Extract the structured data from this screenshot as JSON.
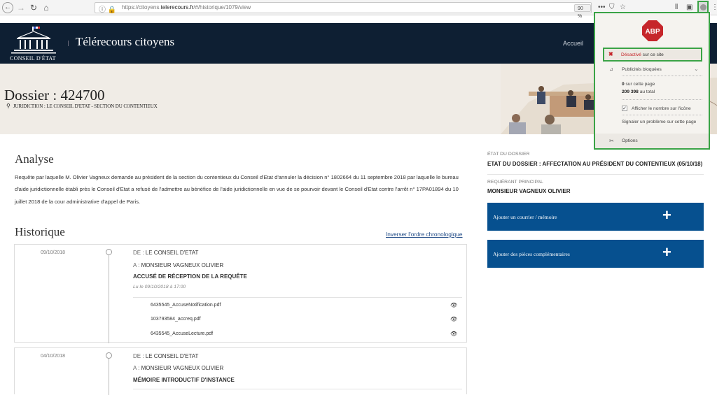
{
  "browser": {
    "url_prefix": "https://citoyens.",
    "url_domain": "telerecours.fr",
    "url_suffix": "/#/historique/1079/view",
    "zoom": "90 %"
  },
  "header": {
    "logo_text": "CONSEIL D'ÉTAT",
    "site_title": "Télérecours citoyens",
    "nav_home": "Accueil"
  },
  "hero": {
    "dossier_title": "Dossier : 424700",
    "juridiction": "JURIDICTION : LE CONSEIL D'ETAT - SECTION DU CONTENTIEUX"
  },
  "analyse": {
    "heading": "Analyse",
    "text": "Requête par laquelle M. Olivier Vagneux demande au président de la section du contentieux du Conseil d'Etat d'annuler la décision n° 1802664 du 11 septembre 2018 par laquelle le bureau d'aide juridictionnelle établi près le Conseil d'Etat a refusé de l'admettre au bénéfice de l'aide juridictionnelle en vue de se pourvoir devant le Conseil d'Etat contre l'arrêt n° 17PA01894 du 10 juillet 2018 de la cour administrative d'appel de Paris."
  },
  "historique": {
    "heading": "Historique",
    "invert_link": "Inverser l'ordre chronologique",
    "de_label": "DE :",
    "a_label": "A :",
    "entries": [
      {
        "date": "09/10/2018",
        "de": "LE CONSEIL D'ETAT",
        "a": "MONSIEUR VAGNEUX OLIVIER",
        "title": "ACCUSÉ DE RÉCEPTION DE LA REQUÊTE",
        "lu": "Lu le 09/10/2018 à 17:00",
        "files": [
          "6435545_AccuseNotification.pdf",
          "103793584_accreq.pdf",
          "6435545_AccuseLecture.pdf"
        ]
      },
      {
        "date": "04/10/2018",
        "de": "LE CONSEIL D'ETAT",
        "a": "MONSIEUR VAGNEUX OLIVIER",
        "title": "MÉMOIRE INTRODUCTIF D'INSTANCE"
      }
    ]
  },
  "sidebar": {
    "etat_label": "ÉTAT DU DOSSIER",
    "etat_value": "ETAT DU DOSSIER : AFFECTATION AU PRÉSIDENT DU CONTENTIEUX (05/10/18)",
    "requerant_label": "REQUÉRANT PRINCIPAL",
    "requerant_value": "MONSIEUR VAGNEUX OLIVIER",
    "action1": "Ajouter un courrier / mémoire",
    "action2": "Ajouter des pièces complémentaires"
  },
  "abp": {
    "logo": "ABP",
    "disabled_word": "Désactivé",
    "disabled_rest": "sur ce site",
    "blocked_ads": "Publicités bloquées",
    "page_count": "0",
    "page_label": "sur cette page",
    "total_count": "209 398",
    "total_label": "au total",
    "show_count_label": "Afficher le nombre sur l'icône",
    "report": "Signaler un problème sur cette page",
    "options": "Options"
  },
  "colors": {
    "header_bg": "#0e1f33",
    "action_blue": "#06508f",
    "abp_green": "#3aa346",
    "abp_red": "#c6262b"
  }
}
